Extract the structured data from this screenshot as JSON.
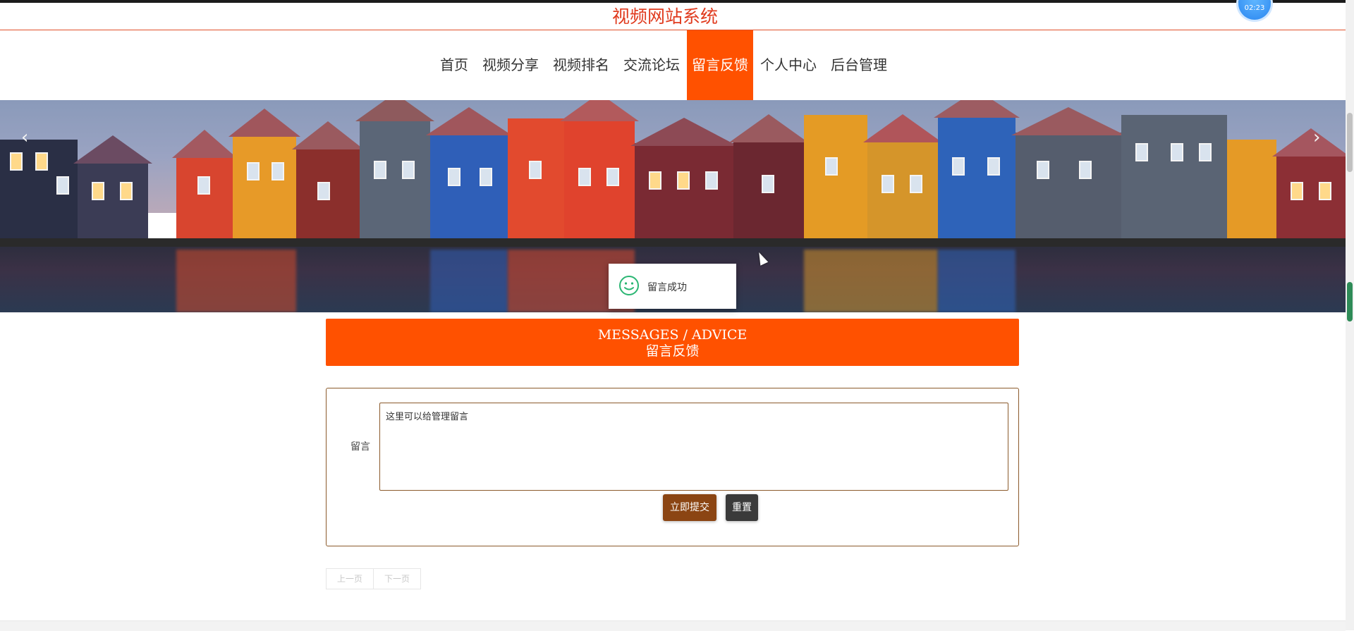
{
  "header": {
    "site_title": "视频网站系统",
    "avatar_text": "02:23"
  },
  "nav": {
    "items": [
      {
        "label": "首页",
        "active": false
      },
      {
        "label": "视频分享",
        "active": false
      },
      {
        "label": "视频排名",
        "active": false
      },
      {
        "label": "交流论坛",
        "active": false
      },
      {
        "label": "留言反馈",
        "active": true
      },
      {
        "label": "个人中心",
        "active": false
      },
      {
        "label": "后台管理",
        "active": false
      }
    ]
  },
  "banner": {
    "prev_icon": "chevron-left-icon",
    "next_icon": "chevron-right-icon",
    "prev_glyph": "‹",
    "next_glyph": "›"
  },
  "toast": {
    "icon": "smile-icon",
    "text": "留言成功"
  },
  "section": {
    "title_en": "MESSAGES / ADVICE",
    "title_cn": "留言反馈"
  },
  "form": {
    "label": "留言",
    "textarea_value": "这里可以给管理留言",
    "submit_label": "立即提交",
    "reset_label": "重置"
  },
  "pager": {
    "prev_label": "上一页",
    "next_label": "下一页"
  },
  "colors": {
    "accent": "#ff5100",
    "title_red": "#e03a1e",
    "brown": "#8b4513",
    "dark_btn": "#3a3a3a"
  }
}
